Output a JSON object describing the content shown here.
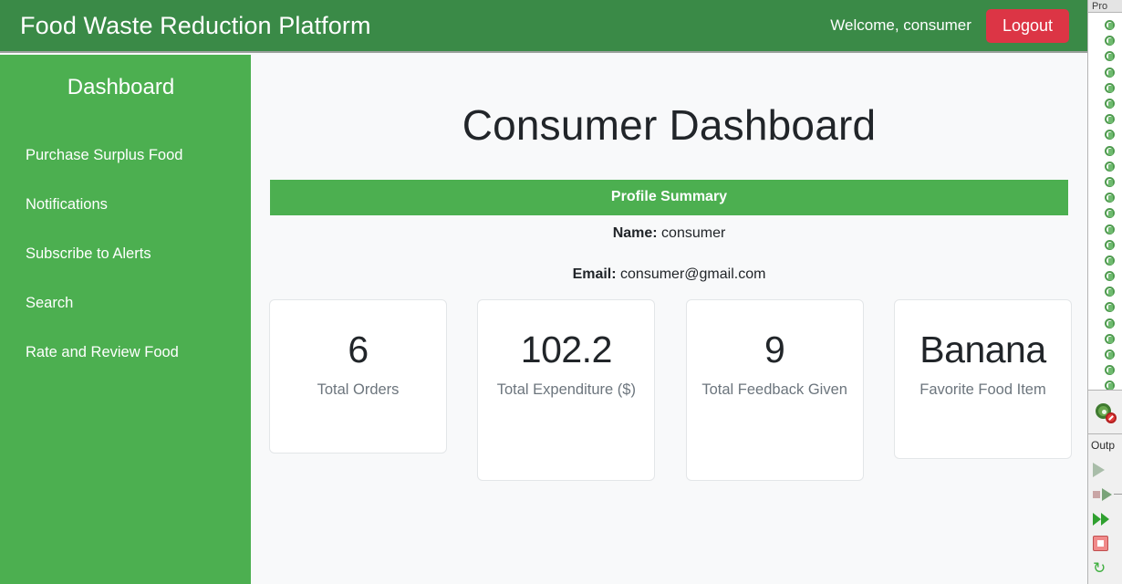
{
  "header": {
    "brand": "Food Waste Reduction Platform",
    "welcome": "Welcome, consumer",
    "logout_label": "Logout",
    "bg_color": "#3a8a47",
    "logout_color": "#dc3545"
  },
  "sidebar": {
    "title": "Dashboard",
    "bg_color": "#4caf50",
    "items": [
      {
        "label": "Purchase Surplus Food"
      },
      {
        "label": "Notifications"
      },
      {
        "label": "Subscribe to Alerts"
      },
      {
        "label": "Search"
      },
      {
        "label": "Rate and Review Food"
      }
    ]
  },
  "main": {
    "page_title": "Consumer Dashboard",
    "profile": {
      "section_title": "Profile Summary",
      "section_color": "#4caf50",
      "name_label": "Name:",
      "name_value": "consumer",
      "email_label": "Email:",
      "email_value": "consumer@gmail.com"
    },
    "stats": [
      {
        "value": "6",
        "label": "Total Orders"
      },
      {
        "value": "102.2",
        "label": "Total Expenditure ($)"
      },
      {
        "value": "9",
        "label": "Total Feedback Given"
      },
      {
        "value": "Banana",
        "label": "Favorite Food Item"
      }
    ]
  },
  "ide_strip": {
    "tab_label": "Pro",
    "output_label": "Outp",
    "tree_icon_name": "green-leaf-node-icon",
    "tree_row_count": 24,
    "gear_icon_name": "disabled-settings-icon",
    "debug_buttons": [
      {
        "name": "resume-program-button"
      },
      {
        "name": "step-over-button"
      },
      {
        "name": "fast-forward-button"
      },
      {
        "name": "stop-button"
      },
      {
        "name": "rerun-button"
      }
    ]
  }
}
